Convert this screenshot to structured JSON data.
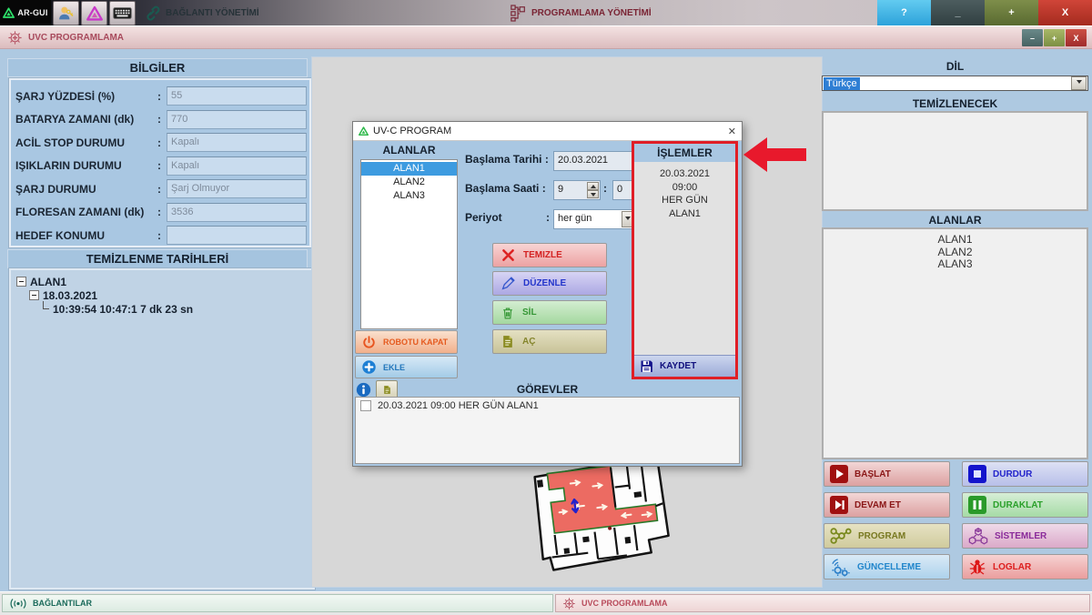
{
  "top_bar": {
    "logo_label": "AR-GUI",
    "menu_connection": "BAĞLANTI YÖNETİMİ",
    "menu_programming": "PROGRAMLAMA YÖNETİMİ",
    "btn_help": "?",
    "btn_min": "_",
    "btn_max": "+",
    "btn_close": "X"
  },
  "window_bar": {
    "title": "UVC PROGRAMLAMA",
    "btn_min": "–",
    "btn_max": "+",
    "btn_close": "X"
  },
  "info_panel": {
    "title": "BİLGİLER",
    "separator": ":",
    "fields": [
      {
        "label": "ŞARJ YÜZDESİ (%)",
        "value": "55"
      },
      {
        "label": "BATARYA ZAMANI (dk)",
        "value": "770"
      },
      {
        "label": "ACİL STOP DURUMU",
        "value": "Kapalı"
      },
      {
        "label": "IŞIKLARIN DURUMU",
        "value": "Kapalı"
      },
      {
        "label": "ŞARJ DURUMU",
        "value": "Şarj Olmuyor"
      },
      {
        "label": "FLORESAN ZAMANI (dk)",
        "value": "3536"
      },
      {
        "label": "HEDEF KONUMU",
        "value": ""
      }
    ]
  },
  "clean_dates": {
    "title": "TEMİZLENME TARİHLERİ",
    "root": "ALAN1",
    "date": "18.03.2021",
    "detail": "10:39:54 10:47:1  7 dk 23 sn"
  },
  "dialog": {
    "title": "UV-C PROGRAM",
    "close": "✕",
    "areas_title": "ALANLAR",
    "areas": [
      "ALAN1",
      "ALAN2",
      "ALAN3"
    ],
    "selected_area": "ALAN1",
    "form": {
      "date_label": "Başlama Tarihi :",
      "date_value": "20.03.2021",
      "time_label": "Başlama Saati :",
      "hour": "9",
      "time_separator": ":",
      "minute": "0",
      "period_label": "Periyot",
      "period_separator": ":",
      "period_value": "her gün"
    },
    "actions": {
      "clean": "TEMIZLE",
      "edit": "DÜZENLE",
      "delete": "SİL",
      "open": "AÇ",
      "shutdown": "ROBOTU KAPAT",
      "add": "EKLE",
      "save": "KAYDET"
    },
    "operations": {
      "title": "İŞLEMLER",
      "lines": [
        "20.03.2021",
        "09:00",
        "HER GÜN",
        "ALAN1"
      ]
    },
    "tasks": {
      "title": "GÖREVLER",
      "item": "20.03.2021   09:00  HER GÜN  ALAN1"
    }
  },
  "right_panel": {
    "language_title": "DİL",
    "language_value": "Türkçe",
    "to_clean_title": "TEMİZLENECEK",
    "areas_title": "ALANLAR",
    "areas": [
      "ALAN1",
      "ALAN2",
      "ALAN3"
    ],
    "buttons": {
      "start": "BAŞLAT",
      "stop": "DURDUR",
      "resume": "DEVAM ET",
      "pause": "DURAKLAT",
      "program": "PROGRAM",
      "systems": "SİSTEMLER",
      "update": "GÜNCELLEME",
      "logs": "LOGLAR"
    }
  },
  "status_bar": {
    "connections": "BAĞLANTILAR",
    "uvc": "UVC PROGRAMLAMA"
  },
  "colors": {
    "annotation_red": "#e8192c",
    "panel_blue": "#a9c7e2",
    "selection_blue": "#3d9be0",
    "map_area_red": "#ec6b62"
  }
}
